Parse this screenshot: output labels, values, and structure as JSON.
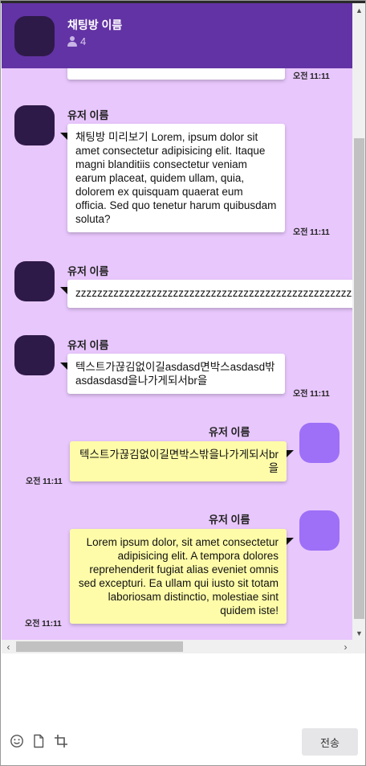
{
  "header": {
    "room_name": "채팅방 이름",
    "member_count": "4",
    "member_icon": "person-icon"
  },
  "messages": {
    "m0": {
      "time": "오전 11:11"
    },
    "m1": {
      "user": "유저 이름",
      "text": "채팅방 미리보기 Lorem, ipsum dolor sit amet consectetur adipisicing elit. Itaque magni blanditiis consectetur veniam earum placeat, quidem ullam, quia, dolorem ex quisquam quaerat eum officia. Sed quo tenetur harum quibusdam soluta?",
      "time": "오전 11:11"
    },
    "m2": {
      "user": "유저 이름",
      "text": "zzzzzzzzzzzzzzzzzzzzzzzzzzzzzzzzzzzzzzzzzzzzzzzzzzzzzzzzzzzzzzzzz"
    },
    "m3": {
      "user": "유저 이름",
      "text": "텍스트가끊김없이길asdasd면박스asdasd밖asdasdasd을나가게되서br을",
      "time": "오전 11:11"
    },
    "m4": {
      "user": "유저 이름",
      "text": "텍스트가끊김없이길면박스밖을나가게되서br을",
      "time": "오전 11:11"
    },
    "m5": {
      "user": "유저 이름",
      "text": "Lorem ipsum dolor, sit amet consectetur adipisicing elit. A tempora dolores reprehenderit fugiat alias eveniet omnis sed excepturi. Ea ullam qui iusto sit totam laboriosam distinctio, molestiae sint quidem iste!",
      "time": "오전 11:11"
    }
  },
  "input": {
    "value": "",
    "send_label": "전송",
    "tools": [
      "emoji-icon",
      "file-icon",
      "crop-icon"
    ]
  },
  "colors": {
    "header_bg": "#6233a4",
    "chat_bg": "#e8c7fd",
    "other_avatar": "#2e1a48",
    "my_avatar": "#9e6ff7",
    "my_bubble": "#fefca8",
    "other_bubble": "#ffffff"
  }
}
